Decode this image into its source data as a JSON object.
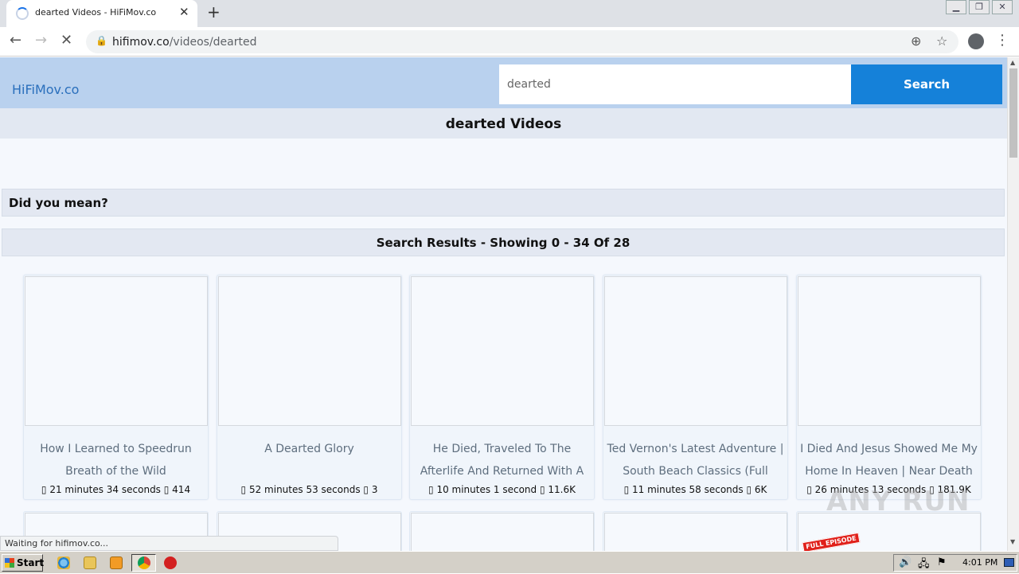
{
  "browser": {
    "tab_title": "dearted Videos - HiFiMov.co",
    "new_tab_icon": "plus-icon",
    "url_domain": "hifimov.co",
    "url_path": "/videos/dearted",
    "status_text": "Waiting for hifimov.co..."
  },
  "site": {
    "logo": "HiFiMov.co",
    "search_value": "dearted",
    "search_button": "Search",
    "videos_heading": "dearted Videos",
    "did_you_mean": "Did you mean?",
    "results_summary": "Search Results - Showing 0 - 34 Of 28"
  },
  "videos": [
    {
      "title": "How I Learned to Speedrun Breath of the Wild",
      "duration": "21 minutes 34 seconds",
      "views": "414"
    },
    {
      "title": "A Dearted Glory",
      "duration": "52 minutes 53 seconds",
      "views": "3"
    },
    {
      "title": "He Died, Traveled To The Afterlife And Returned With A",
      "duration": "10 minutes 1 second",
      "views": "11.6K"
    },
    {
      "title": "Ted Vernon's Latest Adventure | South Beach Classics (Full",
      "duration": "11 minutes 58 seconds",
      "views": "6K"
    },
    {
      "title": "I Died And Jesus Showed Me My Home In Heaven | Near Death",
      "duration": "26 minutes 13 seconds",
      "views": "181.9K"
    }
  ],
  "second_row_badge": "FULL EPISODE",
  "watermark": "ANY RUN",
  "taskbar": {
    "start_label": "Start",
    "clock": "4:01 PM"
  }
}
